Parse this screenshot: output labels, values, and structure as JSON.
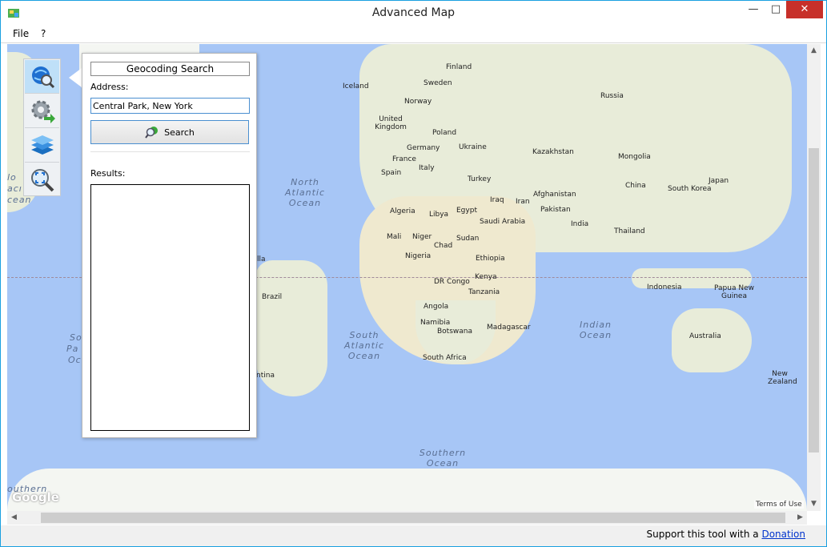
{
  "window": {
    "title": "Advanced Map",
    "minimize_glyph": "—",
    "maximize_glyph": "□",
    "close_glyph": "✕"
  },
  "menu": {
    "items": [
      "File",
      "?"
    ]
  },
  "toolbar": {
    "tools": [
      {
        "icon": "globe-search-icon",
        "active": true
      },
      {
        "icon": "gear-arrow-icon",
        "active": false
      },
      {
        "icon": "layers-icon",
        "active": false
      },
      {
        "icon": "zoom-extent-icon",
        "active": false
      }
    ]
  },
  "panel": {
    "title": "Geocoding Search",
    "address_label": "Address:",
    "address_value": "Central Park, New York",
    "search_label": "Search",
    "results_label": "Results:"
  },
  "map": {
    "countries": [
      "Finland",
      "Iceland",
      "Sweden",
      "Russia",
      "Norway",
      "United Kingdom",
      "Poland",
      "Germany",
      "Ukraine",
      "Kazakhstan",
      "Mongolia",
      "France",
      "Italy",
      "Spain",
      "Turkey",
      "China",
      "South Korea",
      "Japan",
      "Iraq",
      "Iran",
      "Afghanistan",
      "Pakistan",
      "Algeria",
      "Libya",
      "Egypt",
      "Saudi Arabia",
      "India",
      "Thailand",
      "Mali",
      "Niger",
      "Chad",
      "Sudan",
      "Nigeria",
      "Ethiopia",
      "DR Congo",
      "Kenya",
      "Indonesia",
      "Papua New Guinea",
      "Tanzania",
      "Brazil",
      "Angola",
      "Namibia",
      "Botswana",
      "Madagascar",
      "South Africa",
      "Australia",
      "New Zealand"
    ],
    "oceans": [
      "North Atlantic Ocean",
      "South Atlantic Ocean",
      "Indian Ocean",
      "Southern Ocean"
    ],
    "edge_labels": [
      "lo",
      "acı",
      "cean",
      "lla",
      "So",
      "Pa",
      "Oc",
      "ntina",
      "outhern"
    ],
    "logo": "Google",
    "terms": "Terms of Use"
  },
  "status": {
    "text": "Support this tool with a ",
    "link": "Donation"
  },
  "colors": {
    "ocean": "#a7c6f6",
    "land": "#e8ecd9",
    "close_button": "#c7302a",
    "window_border": "#1aa0e0"
  }
}
